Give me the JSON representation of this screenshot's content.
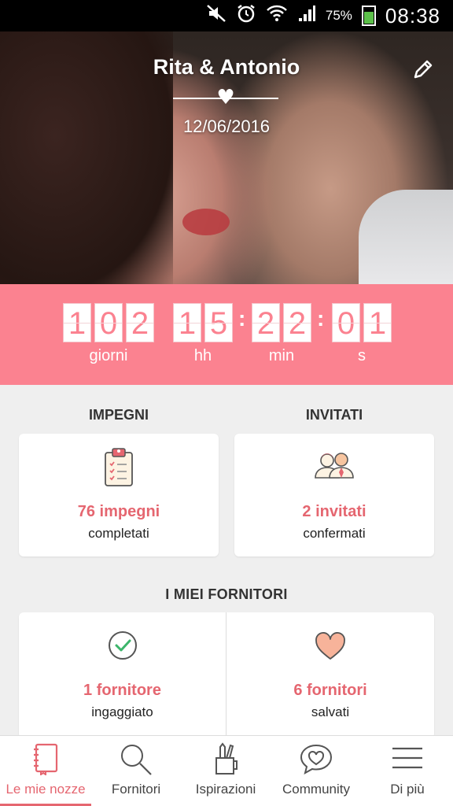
{
  "status_bar": {
    "battery": "75%",
    "time": "08:38",
    "icons": [
      "mute-icon",
      "alarm-icon",
      "wifi-icon",
      "signal-icon",
      "battery-icon"
    ]
  },
  "hero": {
    "couple": "Rita & Antonio",
    "date": "12/06/2016",
    "edit_icon": "pencil-icon"
  },
  "countdown": {
    "days": [
      "1",
      "0",
      "2"
    ],
    "hours": [
      "1",
      "5"
    ],
    "minutes": [
      "2",
      "2"
    ],
    "seconds": [
      "0",
      "1"
    ],
    "labels": {
      "days": "giorni",
      "hours": "hh",
      "minutes": "min",
      "seconds": "s"
    }
  },
  "impegni": {
    "title": "IMPEGNI",
    "value": "76 impegni",
    "sub": "completati",
    "icon": "clipboard-checklist-icon"
  },
  "invitati": {
    "title": "INVITATI",
    "value": "2 invitati",
    "sub": "confermati",
    "icon": "couple-guests-icon"
  },
  "fornitori": {
    "title": "I MIEI FORNITORI",
    "hired": {
      "value": "1 fornitore",
      "sub": "ingaggiato",
      "icon": "check-circle-icon"
    },
    "saved": {
      "value": "6 fornitori",
      "sub": "salvati",
      "icon": "heart-icon"
    }
  },
  "nav": [
    {
      "label": "Le mie nozze",
      "icon": "notebook-icon",
      "active": true
    },
    {
      "label": "Fornitori",
      "icon": "search-icon"
    },
    {
      "label": "Ispirazioni",
      "icon": "pencil-cup-icon"
    },
    {
      "label": "Community",
      "icon": "heart-bubble-icon"
    },
    {
      "label": "Di più",
      "icon": "menu-icon"
    }
  ],
  "colors": {
    "accent": "#fb8290",
    "accent_text": "#e56670",
    "background": "#efefef"
  }
}
